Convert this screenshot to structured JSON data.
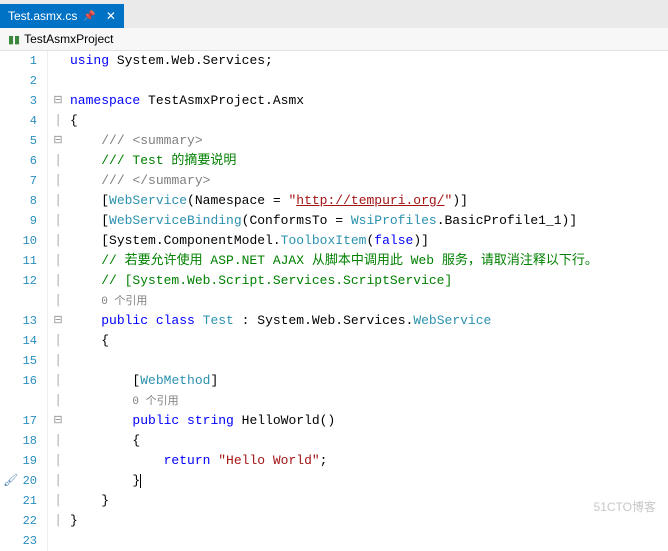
{
  "tab": {
    "filename": "Test.asmx.cs"
  },
  "breadcrumb": {
    "project": "TestAsmxProject"
  },
  "refs": {
    "label": "0 个引用"
  },
  "code": {
    "using_kw": "using",
    "using_ns": "System.Web.Services;",
    "ns_kw": "namespace",
    "ns_name": "TestAsmxProject.Asmx",
    "ob": "{",
    "cb": "}",
    "sum_open": "/// ",
    "sum_open_tag": "<summary>",
    "sum_text": "/// Test 的摘要说明",
    "sum_close": "/// ",
    "sum_close_tag": "</summary>",
    "attr_ws_open": "[",
    "attr_ws_name": "WebService",
    "attr_ws_mid": "(Namespace = ",
    "attr_ws_q": "\"",
    "attr_ws_url": "http://tempuri.org/",
    "attr_ws_close": ")]",
    "attr_wsb_open": "[",
    "attr_wsb_name": "WebServiceBinding",
    "attr_wsb_mid": "(ConformsTo = ",
    "attr_wsb_enum": "WsiProfiles",
    "attr_wsb_rest": ".BasicProfile1_1)]",
    "attr_tbi_pre": "[System.ComponentModel.",
    "attr_tbi_name": "ToolboxItem",
    "attr_tbi_open": "(",
    "attr_tbi_val": "false",
    "attr_tbi_close": ")]",
    "cmt_cn": "// 若要允许使用 ASP.NET AJAX 从脚本中调用此 Web 服务，请取消注释以下行。",
    "cmt_ss": "// [System.Web.Script.Services.ScriptService]",
    "cls_mod": "public class",
    "cls_name": "Test",
    "cls_colon": " : ",
    "cls_base_ns": "System.Web.Services.",
    "cls_base": "WebService",
    "attr_wm": "[",
    "attr_wm_name": "WebMethod",
    "attr_wm_close": "]",
    "m_mod": "public",
    "m_ret": "string",
    "m_name": " HelloWorld()",
    "ret_kw": "return",
    "ret_str": "\"Hello World\"",
    "semi": ";"
  },
  "lines": [
    "1",
    "2",
    "3",
    "4",
    "5",
    "6",
    "7",
    "8",
    "9",
    "10",
    "11",
    "12",
    "",
    "13",
    "14",
    "15",
    "16",
    "",
    "17",
    "18",
    "19",
    "20",
    "21",
    "22",
    "23"
  ],
  "watermark": "51CTO博客"
}
